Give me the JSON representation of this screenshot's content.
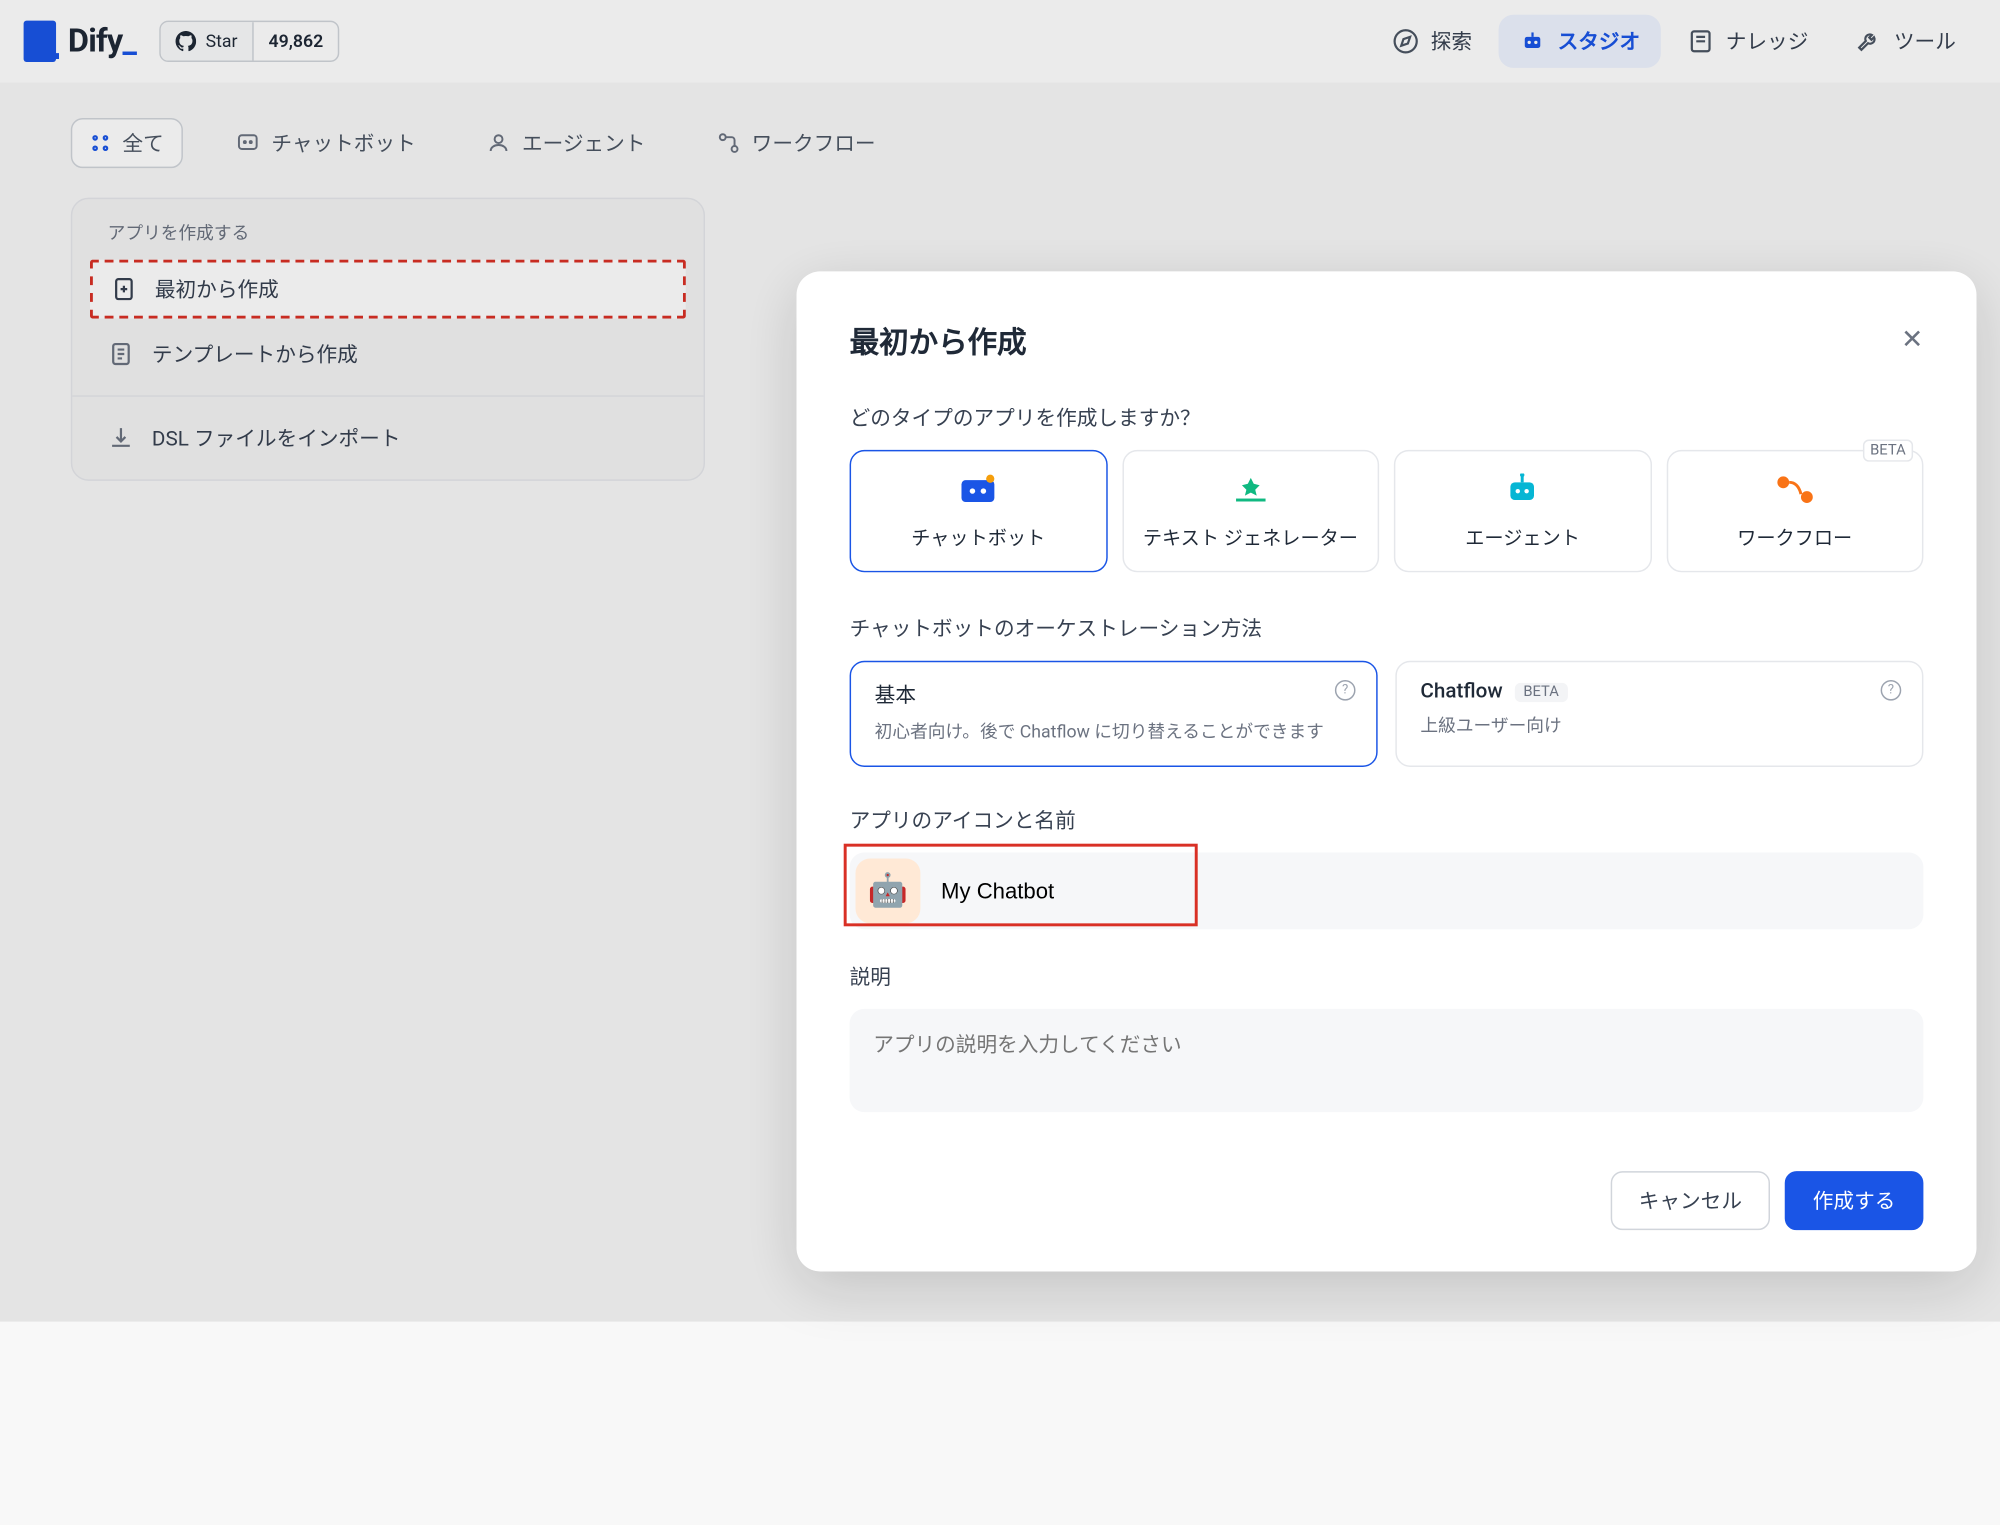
{
  "header": {
    "logo": "Dify",
    "star_label": "Star",
    "star_count": "49,862",
    "nav": [
      {
        "label": "探索",
        "icon": "compass-icon"
      },
      {
        "label": "スタジオ",
        "icon": "robot-icon"
      },
      {
        "label": "ナレッジ",
        "icon": "book-icon"
      },
      {
        "label": "ツール",
        "icon": "tool-icon"
      }
    ]
  },
  "filters": {
    "all": "全て",
    "chatbot": "チャットボット",
    "agent": "エージェント",
    "workflow": "ワークフロー"
  },
  "create_card": {
    "title": "アプリを作成する",
    "from_scratch": "最初から作成",
    "from_template": "テンプレートから作成",
    "import_dsl": "DSL ファイルをインポート"
  },
  "modal": {
    "title": "最初から作成",
    "type_question": "どのタイプのアプリを作成しますか？",
    "types": {
      "chatbot": "チャットボット",
      "textgen": "テキスト ジェネレーター",
      "agent": "エージェント",
      "workflow": "ワークフロー",
      "beta": "BETA"
    },
    "orch_label": "チャットボットのオーケストレーション方法",
    "orch_basic": {
      "title": "基本",
      "desc": "初心者向け。後で Chatflow に切り替えることができます"
    },
    "orch_chatflow": {
      "title": "Chatflow",
      "beta": "BETA",
      "desc": "上級ユーザー向け"
    },
    "icon_name_label": "アプリのアイコンと名前",
    "app_icon": "🤖",
    "app_name": "My Chatbot",
    "desc_label": "説明",
    "desc_placeholder": "アプリの説明を入力してください",
    "cancel": "キャンセル",
    "create": "作成する"
  }
}
